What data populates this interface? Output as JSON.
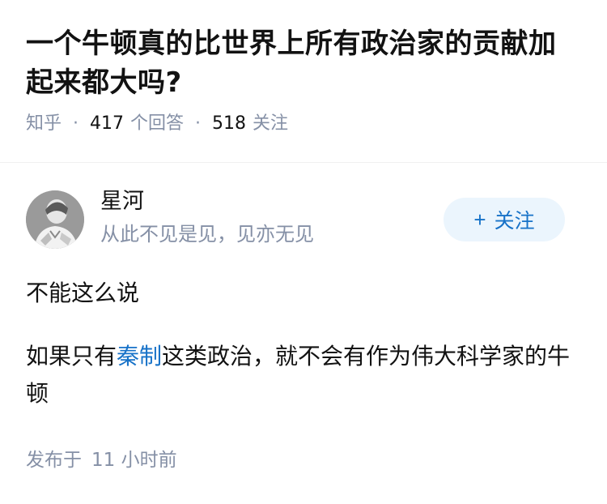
{
  "question": {
    "title": "一个牛顿真的比世界上所有政治家的贡献加起来都大吗?",
    "source": "知乎",
    "answer_count": "417",
    "answer_label": "个回答",
    "follow_count": "518",
    "follow_label": "关注"
  },
  "author": {
    "name": "星河",
    "bio": "从此不见是见，见亦无见",
    "follow_button": {
      "icon": "plus-icon",
      "plus": "+",
      "label": "关注"
    }
  },
  "answer": {
    "paragraph_1": "不能这么说",
    "paragraph_2_before": "如果只有",
    "paragraph_2_link": "秦制",
    "paragraph_2_after": "这类政治，就不会有作为伟大科学家的牛顿",
    "published_label": "发布于",
    "published_time": "11 小时前"
  },
  "colors": {
    "link": "#1772c8",
    "meta": "#8590a6",
    "text": "#121212",
    "button_bg": "#ebf5fd"
  }
}
